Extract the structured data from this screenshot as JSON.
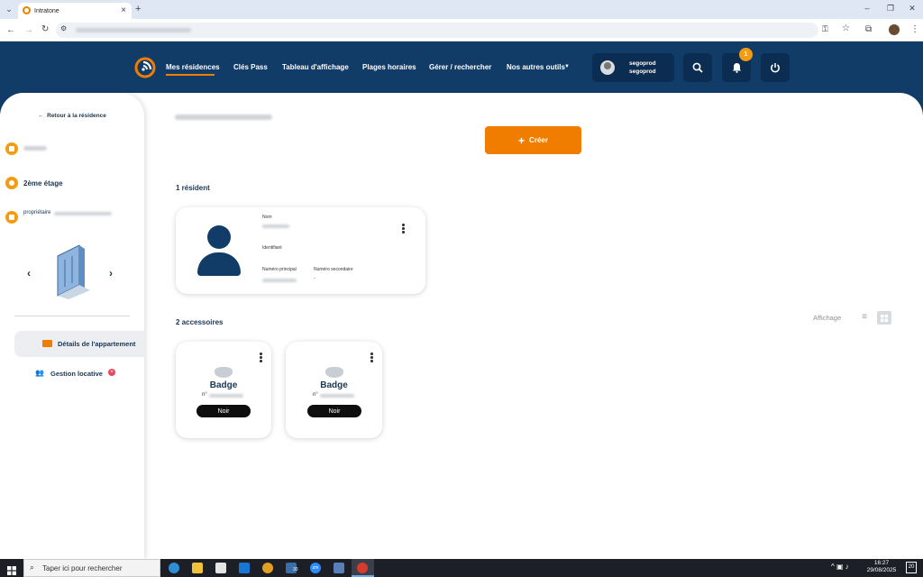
{
  "browser": {
    "tab_title": "Intratone",
    "tab_close": "×",
    "new_tab": "+",
    "win_min": "–",
    "win_restore": "❐",
    "win_close": "✕"
  },
  "header": {
    "nav": [
      "Mes résidences",
      "Clés Pass",
      "Tableau d'affichage",
      "Plages horaires",
      "Gérer / rechercher",
      "Nos autres outils"
    ],
    "user_line1": "segoprod",
    "user_line2": "segoprod",
    "notif_count": "1"
  },
  "sidebar": {
    "back": "Retour à la résidence",
    "floor": "2ème étage",
    "owner_label": "propriétaire",
    "menu": [
      {
        "label": "Détails de l'appartement"
      },
      {
        "label": "Gestion locative"
      }
    ]
  },
  "main": {
    "create_label": "Créer",
    "residents_title": "1 résident",
    "resident": {
      "name_label": "Nom",
      "id_label": "Identifiant",
      "primary_label": "Numéro principal",
      "secondary_label": "Numéro secondaire",
      "secondary_value": "-"
    },
    "accessories_title": "2 accessoires",
    "display_label": "Affichage",
    "accessories": [
      {
        "type": "Badge",
        "num_prefix": "n°",
        "color": "Noir"
      },
      {
        "type": "Badge",
        "num_prefix": "n°",
        "color": "Noir"
      }
    ]
  },
  "taskbar": {
    "search_placeholder": "Taper ici pour rechercher",
    "time": "16:27",
    "date": "29/08/2025",
    "notif": "20",
    "calendar_badge": "30"
  },
  "colors": {
    "header_bg": "#123c68",
    "accent_orange": "#f07d00",
    "dark_text": "#1b3651"
  }
}
